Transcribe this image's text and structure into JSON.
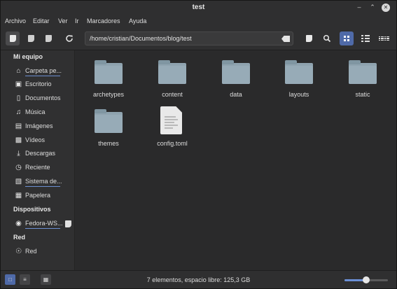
{
  "window": {
    "title": "test"
  },
  "menu": [
    "Archivo",
    "Editar",
    "Ver",
    "Ir",
    "Marcadores",
    "Ayuda"
  ],
  "toolbar": {
    "path": "/home/cristian/Documentos/blog/test",
    "icons": [
      "places-pane-icon",
      "tree-pane-icon",
      "hide-pane-icon",
      "reload-icon",
      "clear-path-icon",
      "bookmark-icon",
      "search-icon",
      "icon-view-icon",
      "list-view-icon",
      "compact-view-icon"
    ]
  },
  "sidebar": {
    "sections": [
      {
        "header": "Mi equipo",
        "items": [
          {
            "label": "Carpeta pe...",
            "icon": "home-icon",
            "underline": true
          },
          {
            "label": "Escritorio",
            "icon": "desktop-icon"
          },
          {
            "label": "Documentos",
            "icon": "documents-icon"
          },
          {
            "label": "Música",
            "icon": "music-icon"
          },
          {
            "label": "Imágenes",
            "icon": "pictures-icon"
          },
          {
            "label": "Vídeos",
            "icon": "videos-icon"
          },
          {
            "label": "Descargas",
            "icon": "downloads-icon"
          },
          {
            "label": "Reciente",
            "icon": "recent-icon"
          },
          {
            "label": "Sistema de...",
            "icon": "filesystem-icon",
            "underline": true
          },
          {
            "label": "Papelera",
            "icon": "trash-icon"
          }
        ]
      },
      {
        "header": "Dispositivos",
        "items": [
          {
            "label": "Fedora-WS...",
            "icon": "disc-icon",
            "underline": true
          }
        ]
      },
      {
        "header": "Red",
        "items": [
          {
            "label": "Red",
            "icon": "network-icon"
          }
        ]
      }
    ]
  },
  "files": [
    {
      "name": "archetypes",
      "type": "folder"
    },
    {
      "name": "content",
      "type": "folder"
    },
    {
      "name": "data",
      "type": "folder"
    },
    {
      "name": "layouts",
      "type": "folder"
    },
    {
      "name": "static",
      "type": "folder"
    },
    {
      "name": "themes",
      "type": "folder"
    },
    {
      "name": "config.toml",
      "type": "file"
    }
  ],
  "statusbar": {
    "text": "7 elementos, espacio libre: 125,3 GB",
    "zoom_fraction": 0.5,
    "accent": "#6b8fd6"
  }
}
